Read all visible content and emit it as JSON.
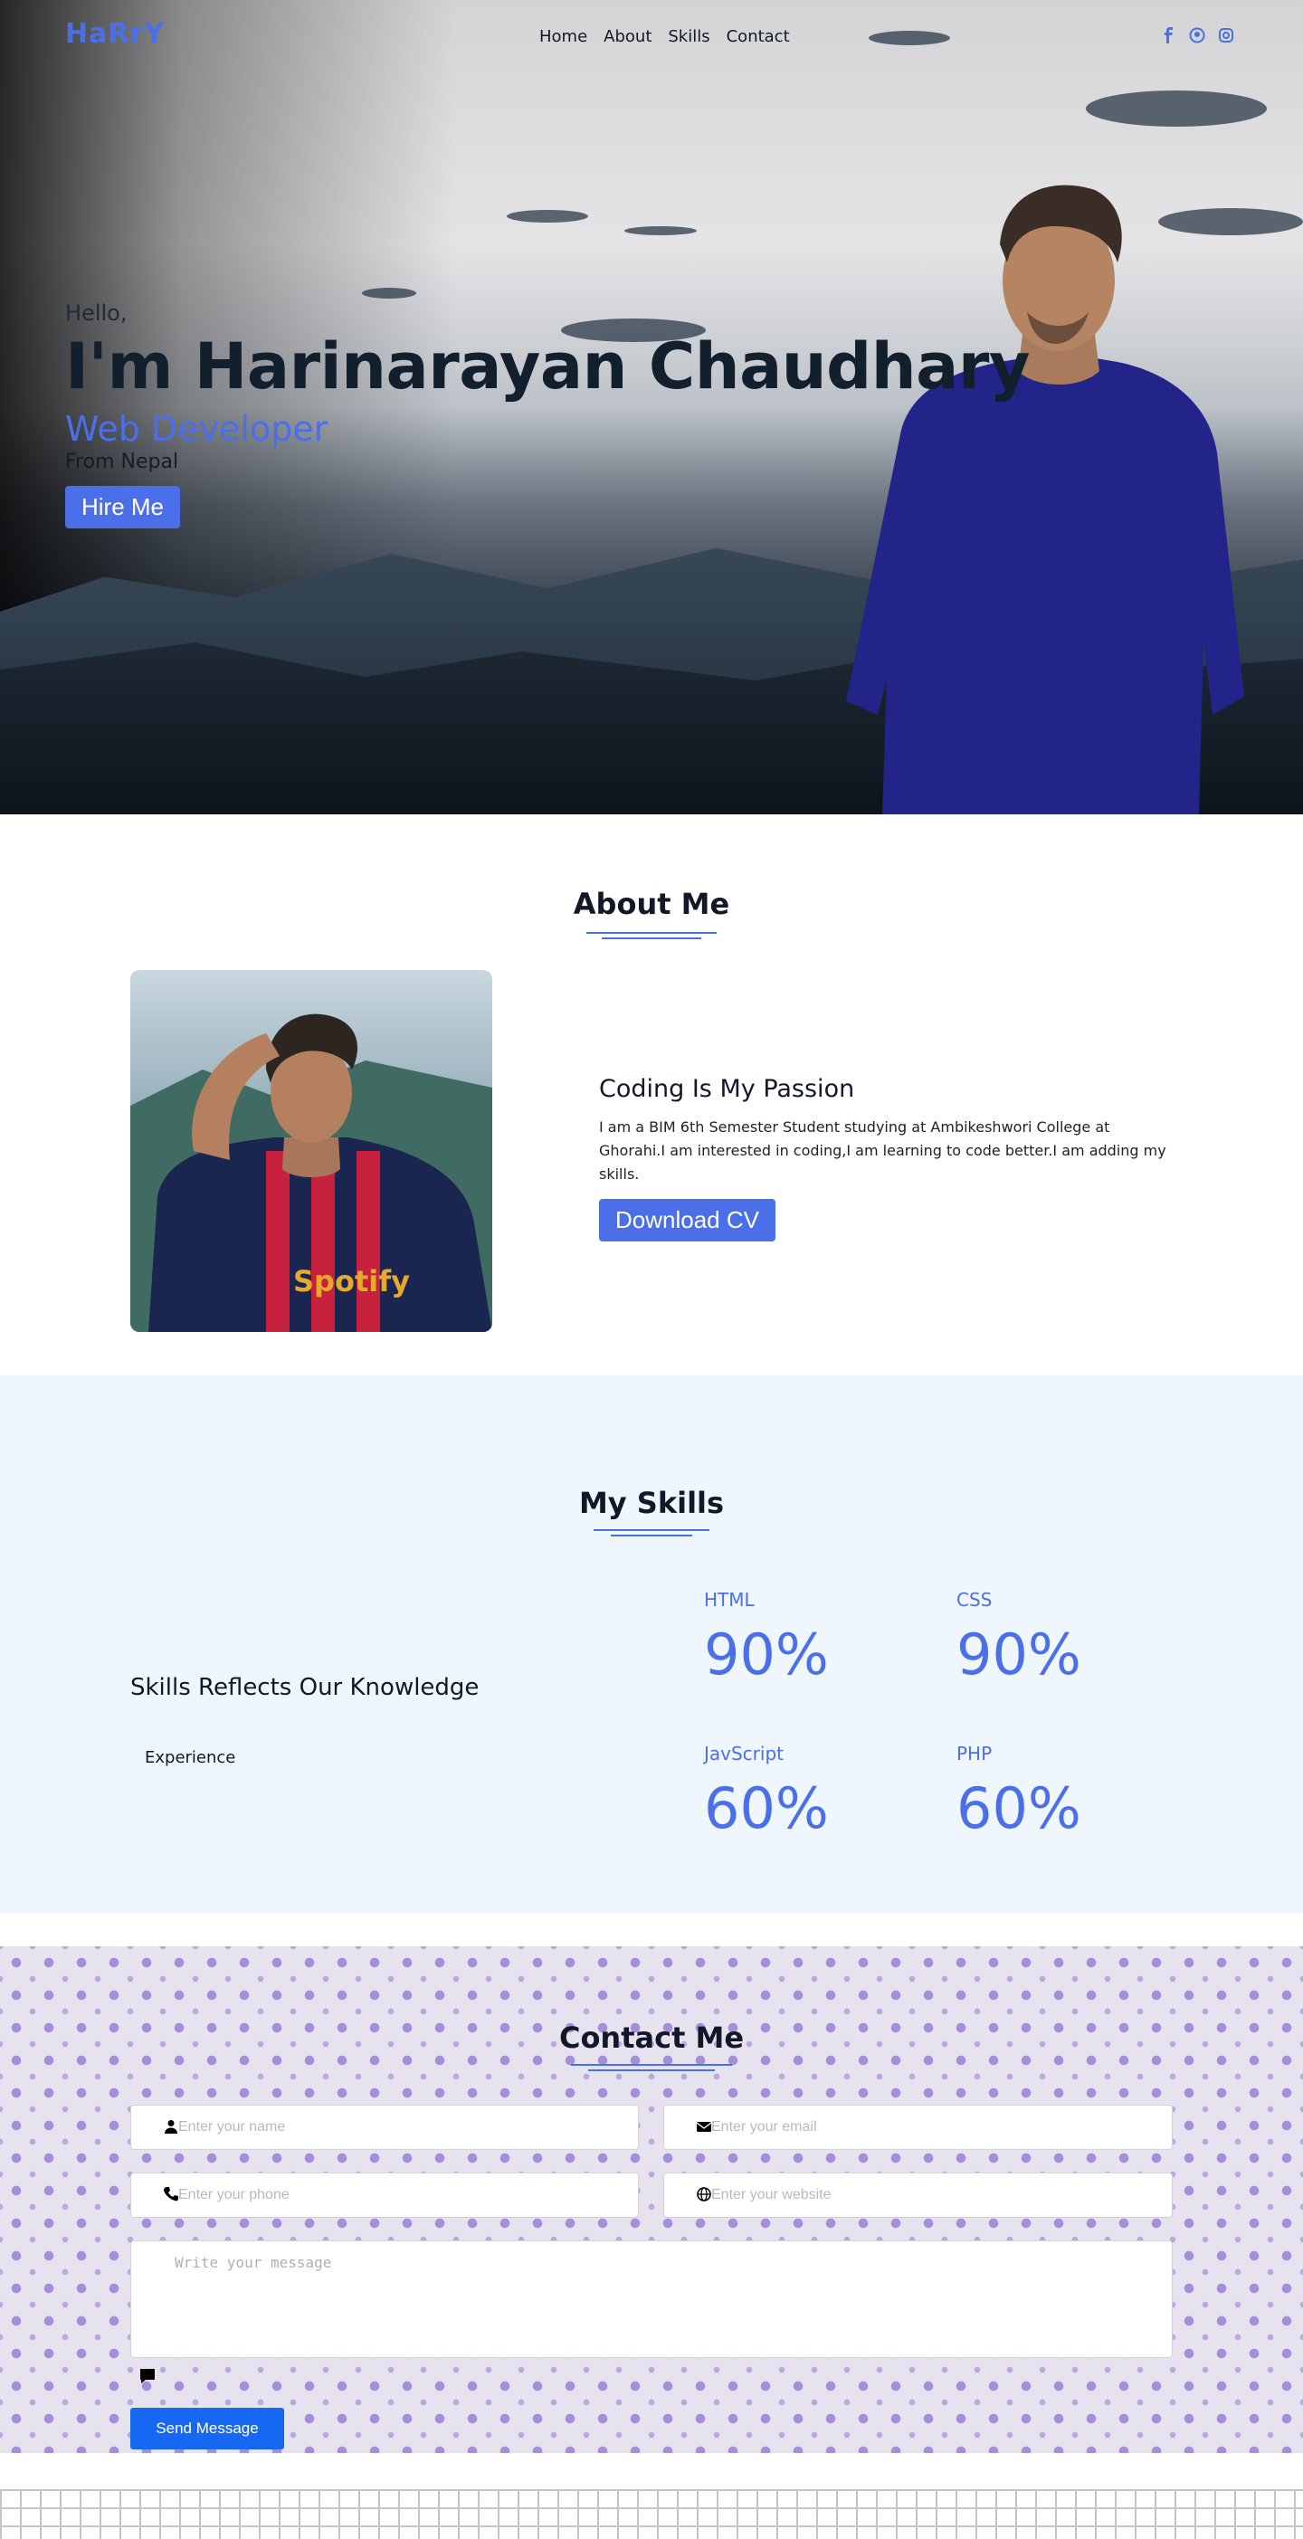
{
  "nav": {
    "logo": "HaRrY",
    "links": [
      "Home",
      "About",
      "Skills",
      "Contact"
    ],
    "socials": [
      "facebook-icon",
      "github-icon",
      "instagram-icon"
    ]
  },
  "hero": {
    "greeting": "Hello,",
    "name": "I'm Harinarayan Chaudhary",
    "role": "Web Developer",
    "location": "From Nepal",
    "cta": "Hire Me"
  },
  "about": {
    "title": "About Me",
    "heading": "Coding Is My Passion",
    "body": "I am a BIM 6th Semester Student studying at Ambikeshwori College at Ghorahi.I am interested in coding,I am learning to code better.I am adding my skills.",
    "cta": "Download CV"
  },
  "skills": {
    "title": "My Skills",
    "heading": "Skills Reflects Our Knowledge",
    "experience_label": "Experience",
    "items": [
      {
        "name": "HTML",
        "value": "90%"
      },
      {
        "name": "CSS",
        "value": "90%"
      },
      {
        "name": "JavScript",
        "value": "60%"
      },
      {
        "name": "PHP",
        "value": "60%"
      }
    ]
  },
  "contact": {
    "title": "Contact Me",
    "name_placeholder": "Enter your name",
    "email_placeholder": "Enter your email",
    "phone_placeholder": "Enter your phone",
    "website_placeholder": "Enter your website",
    "message_placeholder": "Write your message",
    "send": "Send Message"
  },
  "colors": {
    "accent": "#4b6fe8",
    "button_blue": "#1668f2",
    "skills_bg": "#eff6fd"
  }
}
